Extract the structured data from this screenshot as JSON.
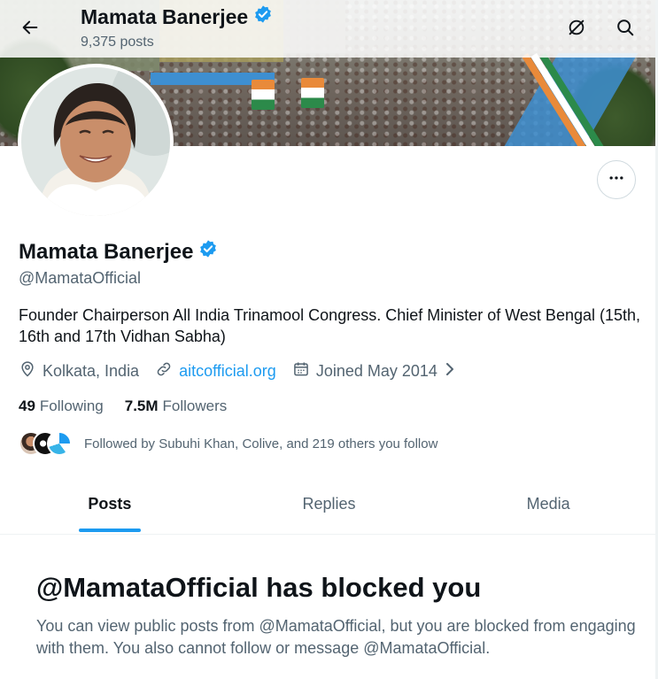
{
  "header": {
    "title": "Mamata Banerjee",
    "posts_count": "9,375 posts"
  },
  "icons": {
    "back": "arrow-left-icon",
    "grok": "grok-icon",
    "search": "search-icon",
    "more": "more-icon",
    "verified": "verified-badge-icon",
    "location": "location-icon",
    "link": "link-icon",
    "calendar": "calendar-icon"
  },
  "profile": {
    "name": "Mamata Banerjee",
    "handle": "@MamataOfficial",
    "bio": "Founder Chairperson All India Trinamool Congress. Chief Minister of West Bengal (15th, 16th and 17th Vidhan Sabha)",
    "location": "Kolkata, India",
    "website": "aitcofficial.org",
    "joined": "Joined May 2014",
    "following_count": "49",
    "following_label": "Following",
    "followers_count": "7.5M",
    "followers_label": "Followers",
    "followed_by": "Followed by Subuhi Khan, Colive, and 219 others you follow"
  },
  "tabs": [
    {
      "label": "Posts",
      "active": true
    },
    {
      "label": "Replies",
      "active": false
    },
    {
      "label": "Media",
      "active": false
    }
  ],
  "blocked": {
    "title": "@MamataOfficial has blocked you",
    "message": "You can view public posts from @MamataOfficial, but you are blocked from engaging with them. You also cannot follow or message @MamataOfficial."
  },
  "colors": {
    "accent": "#1d9bf0",
    "text_primary": "#0f1419",
    "text_secondary": "#536471"
  }
}
